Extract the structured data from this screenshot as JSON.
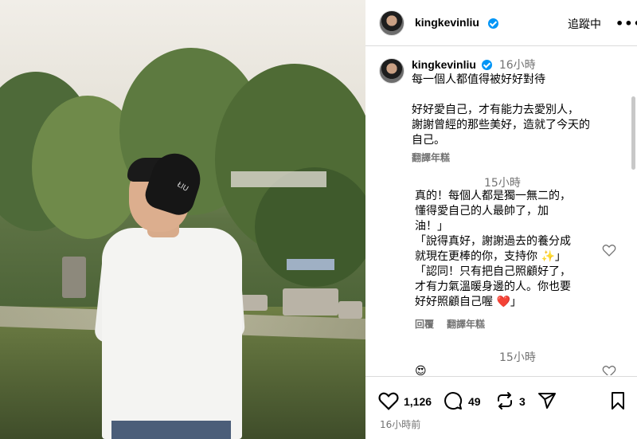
{
  "post": {
    "author": "kingkevinliu",
    "follow_label": "追蹤中",
    "more_label": "•••",
    "caption_time": "16小時",
    "caption_line1": "每一個人都值得被好好對待",
    "caption_line2": "好好愛自己，才有能力去愛別人，",
    "caption_line3": "謝謝曾經的那些美好，造就了今天的",
    "caption_line4": "自己。",
    "translate_label": "翻譯年糕"
  },
  "comments": [
    {
      "time": "15小時",
      "lines": [
        "真的！每個人都是獨一無二的，",
        "懂得愛自己的人最帥了，加",
        "油！」",
        "「說得真好，謝謝過去的養分成",
        "就現在更棒的你，支持你 ✨」",
        "「認同！只有把自己照顧好了，",
        "才有力氣溫暖身邊的人。你也要",
        "好好照顧自己喔 ❤️」"
      ],
      "reply_label": "回覆",
      "translate_label": "翻譯年糕"
    },
    {
      "time": "15小時",
      "text": "😍"
    }
  ],
  "actions": {
    "likes": "1,126",
    "comments": "49",
    "reposts": "3",
    "posted": "16小時前"
  },
  "photo": {
    "beanie_text": "ŁIU"
  }
}
